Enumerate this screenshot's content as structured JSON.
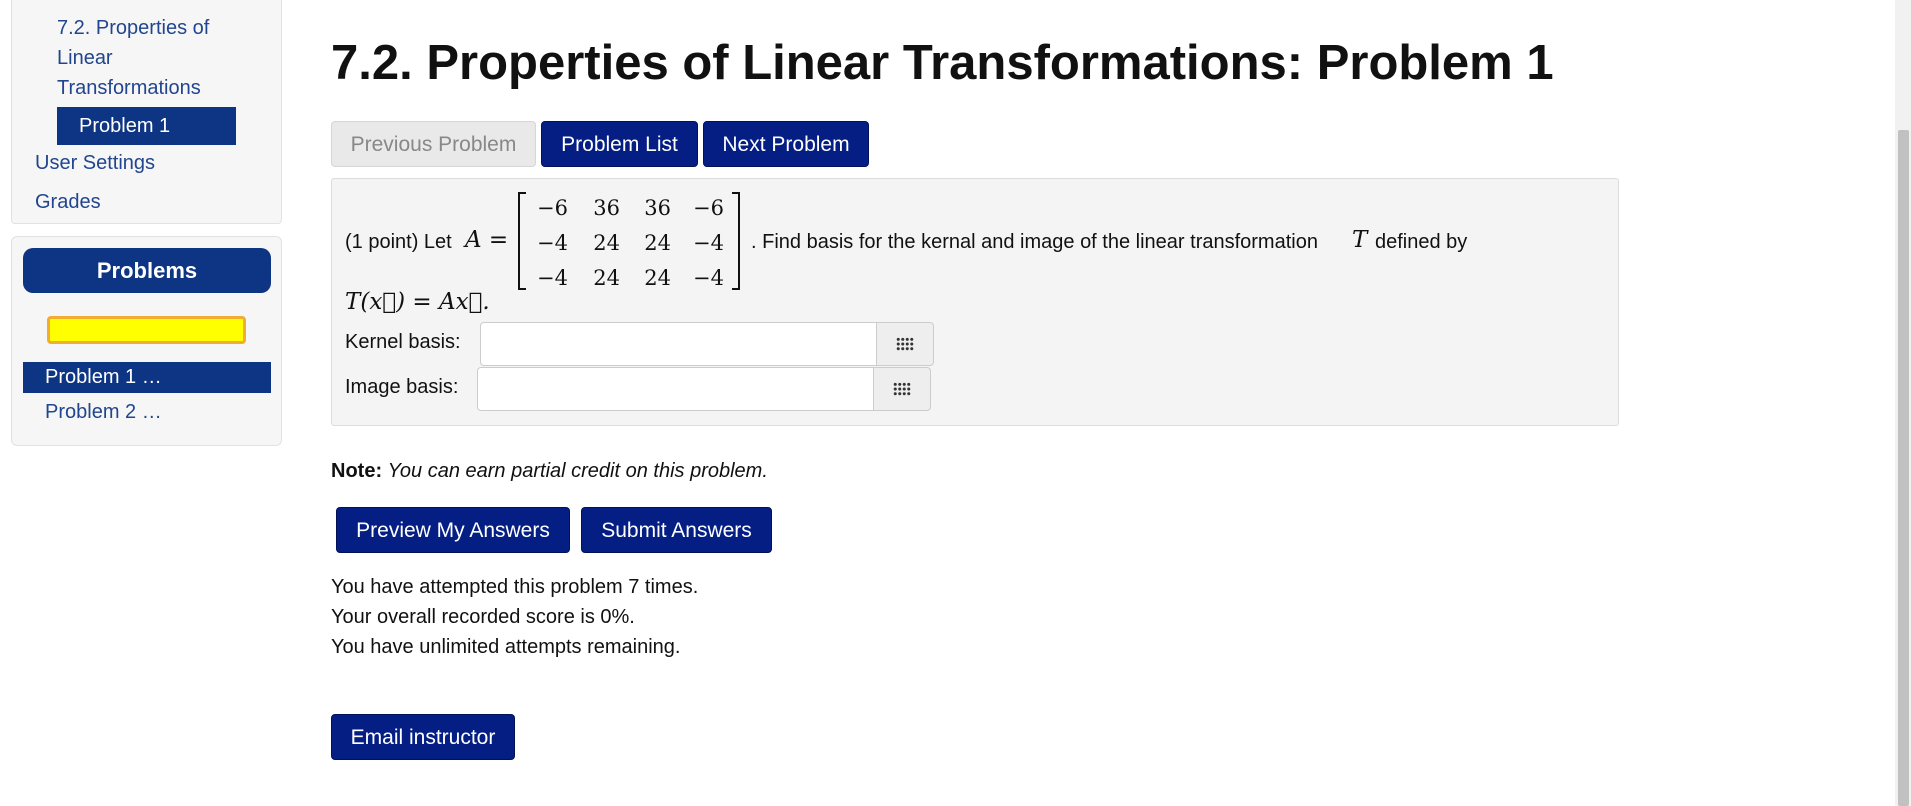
{
  "sidebar": {
    "section_link": "7.2. Properties of Linear Transformations",
    "current_problem": "Problem 1",
    "user_settings": "User Settings",
    "grades": "Grades"
  },
  "problems_panel": {
    "title": "Problems",
    "progress": {
      "fraction": 0,
      "color": "#ffff00",
      "border_color": "#f0ad2e"
    },
    "items": [
      {
        "label": "Problem 1 …",
        "active": true
      },
      {
        "label": "Problem 2 …",
        "active": false
      }
    ]
  },
  "main": {
    "title": "7.2. Properties of Linear Transformations: Problem 1",
    "nav_buttons": {
      "previous": "Previous Problem",
      "list": "Problem List",
      "next": "Next Problem"
    },
    "problem": {
      "points": "(1 point) Let",
      "matrix_var": "A =",
      "matrix": [
        [
          "−6",
          "36",
          "36",
          "−6"
        ],
        [
          "−4",
          "24",
          "24",
          "−4"
        ],
        [
          "−4",
          "24",
          "24",
          "−4"
        ]
      ],
      "text_after": ". Find basis for the kernal and image of the linear transformation",
      "var_T": "T",
      "text_defined": "defined by",
      "definition": "T(x⃗) = Ax⃗.",
      "kernel_label": "Kernel basis:",
      "kernel_value": "",
      "image_label": "Image basis:",
      "image_value": ""
    },
    "note_label": "Note:",
    "note_text": "You can earn partial credit on this problem.",
    "preview_button": "Preview My Answers",
    "submit_button": "Submit Answers",
    "attempts_text": "You have attempted this problem 7 times.",
    "score_text": "Your overall recorded score is 0%.",
    "remaining_text": "You have unlimited attempts remaining.",
    "email_button": "Email instructor"
  },
  "colors": {
    "primary": "#041e84",
    "nav_highlight": "#0e3484",
    "link": "#21468f"
  }
}
